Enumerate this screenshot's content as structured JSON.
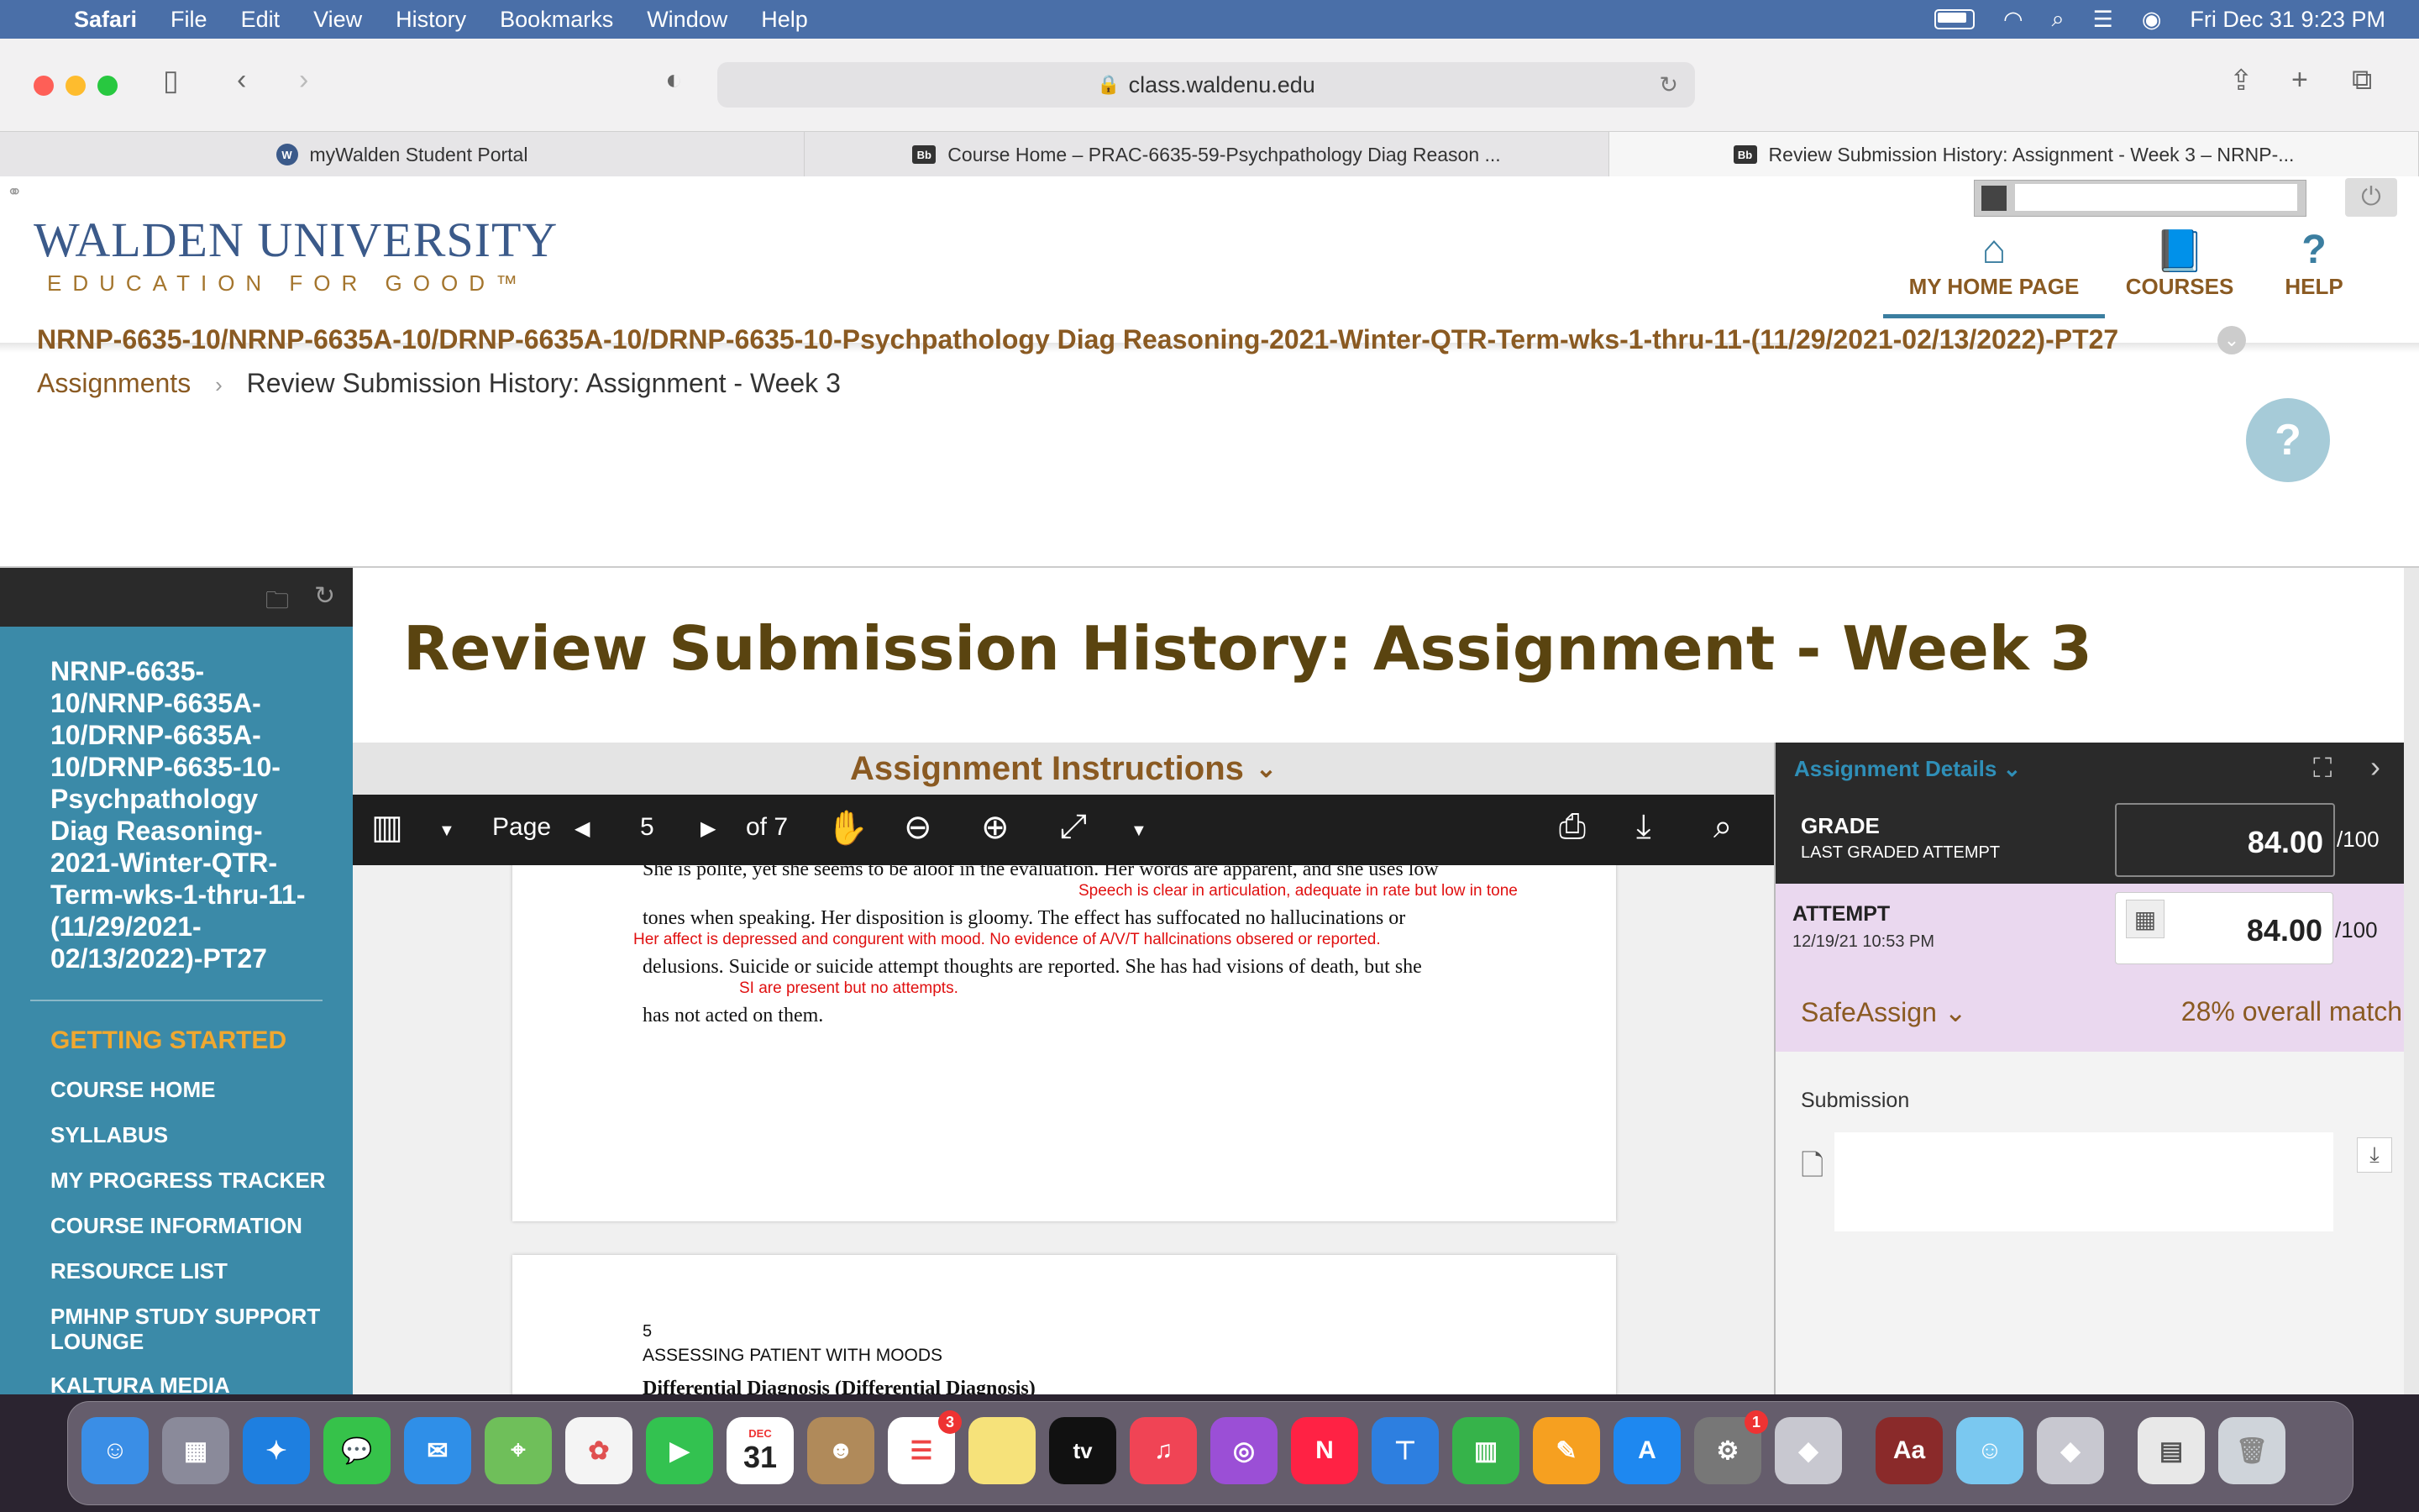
{
  "menubar": {
    "app": "Safari",
    "items": [
      "File",
      "Edit",
      "View",
      "History",
      "Bookmarks",
      "Window",
      "Help"
    ],
    "datetime": "Fri Dec 31  9:23 PM"
  },
  "browser": {
    "url": "class.waldenu.edu",
    "tabs": [
      {
        "label": "myWalden Student Portal",
        "favicon": "W"
      },
      {
        "label": "Course Home – PRAC-6635-59-Psychpathology Diag Reason ...",
        "favicon": "Bb"
      },
      {
        "label": "Review Submission History: Assignment - Week 3 – NRNP-...",
        "favicon": "Bb"
      }
    ]
  },
  "header": {
    "logo_main": "WALDEN UNIVERSITY",
    "logo_sub": "EDUCATION FOR GOOD™",
    "nav": {
      "home": "MY HOME PAGE",
      "courses": "COURSES",
      "help": "HELP"
    }
  },
  "course": {
    "title": "NRNP-6635-10/NRNP-6635A-10/DRNP-6635A-10/DRNP-6635-10-Psychpathology Diag Reasoning-2021-Winter-QTR-Term-wks-1-thru-11-(11/29/2021-02/13/2022)-PT27",
    "breadcrumb_link": "Assignments",
    "breadcrumb_sep": "›",
    "breadcrumb_current": "Review Submission History: Assignment - Week 3"
  },
  "sidebar": {
    "course_name": "NRNP-6635-10/NRNP-6635A-10/DRNP-6635A-10/DRNP-6635-10-Psychpathology Diag Reasoning-2021-Winter-QTR-Term-wks-1-thru-11-(11/29/2021-02/13/2022)-PT27",
    "section": "GETTING STARTED",
    "items": [
      "COURSE HOME",
      "SYLLABUS",
      "MY PROGRESS TRACKER",
      "COURSE INFORMATION",
      "RESOURCE LIST",
      "PMHNP STUDY SUPPORT LOUNGE",
      "KALTURA MEDIA UPLOADER"
    ]
  },
  "main": {
    "title": "Review Submission History: Assignment - Week 3",
    "instructions": "Assignment Instructions"
  },
  "pdf": {
    "page_label": "Page",
    "page": "5",
    "of": "of 7",
    "lines": [
      "She is polite, yet she seems to be aloof in the evaluation. Her words are apparent, and she uses low",
      "tones when speaking. Her disposition is gloomy. The effect has suffocated no hallucinations or",
      "delusions. Suicide or suicide attempt thoughts are reported. She has had visions of death, but she",
      "has not acted on them."
    ],
    "annotations": [
      "Speech is clear in articulation, adequate in rate but low in tone",
      "Her affect is depressed and congurent with mood. No evidence of A/V/T hallcinations obsered or reported.",
      "SI are present but no attempts."
    ],
    "next_page_num": "5",
    "next_page_header": "ASSESSING PATIENT WITH MOODS",
    "next_page_heading": "Differential Diagnosis (Differential Diagnosis)"
  },
  "details": {
    "header": "Assignment Details",
    "grade_label": "GRADE",
    "grade_sub": "LAST GRADED ATTEMPT",
    "grade_value": "84.00",
    "out_of": "/100",
    "attempt_label": "ATTEMPT",
    "attempt_date": "12/19/21 10:53 PM",
    "attempt_value": "84.00",
    "safeassign": "SafeAssign",
    "match": "28% overall match",
    "submission": "Submission"
  },
  "dock": {
    "calendar_month": "DEC",
    "calendar_day": "31",
    "reminders_badge": "3",
    "settings_badge": "1",
    "tv_label": "tv",
    "dictionary_label": "Aa"
  },
  "colors": {
    "brown": "#8a5a22",
    "teal": "#3b8aa8",
    "title_brown": "#5a4410",
    "annotation_red": "#e01010"
  }
}
